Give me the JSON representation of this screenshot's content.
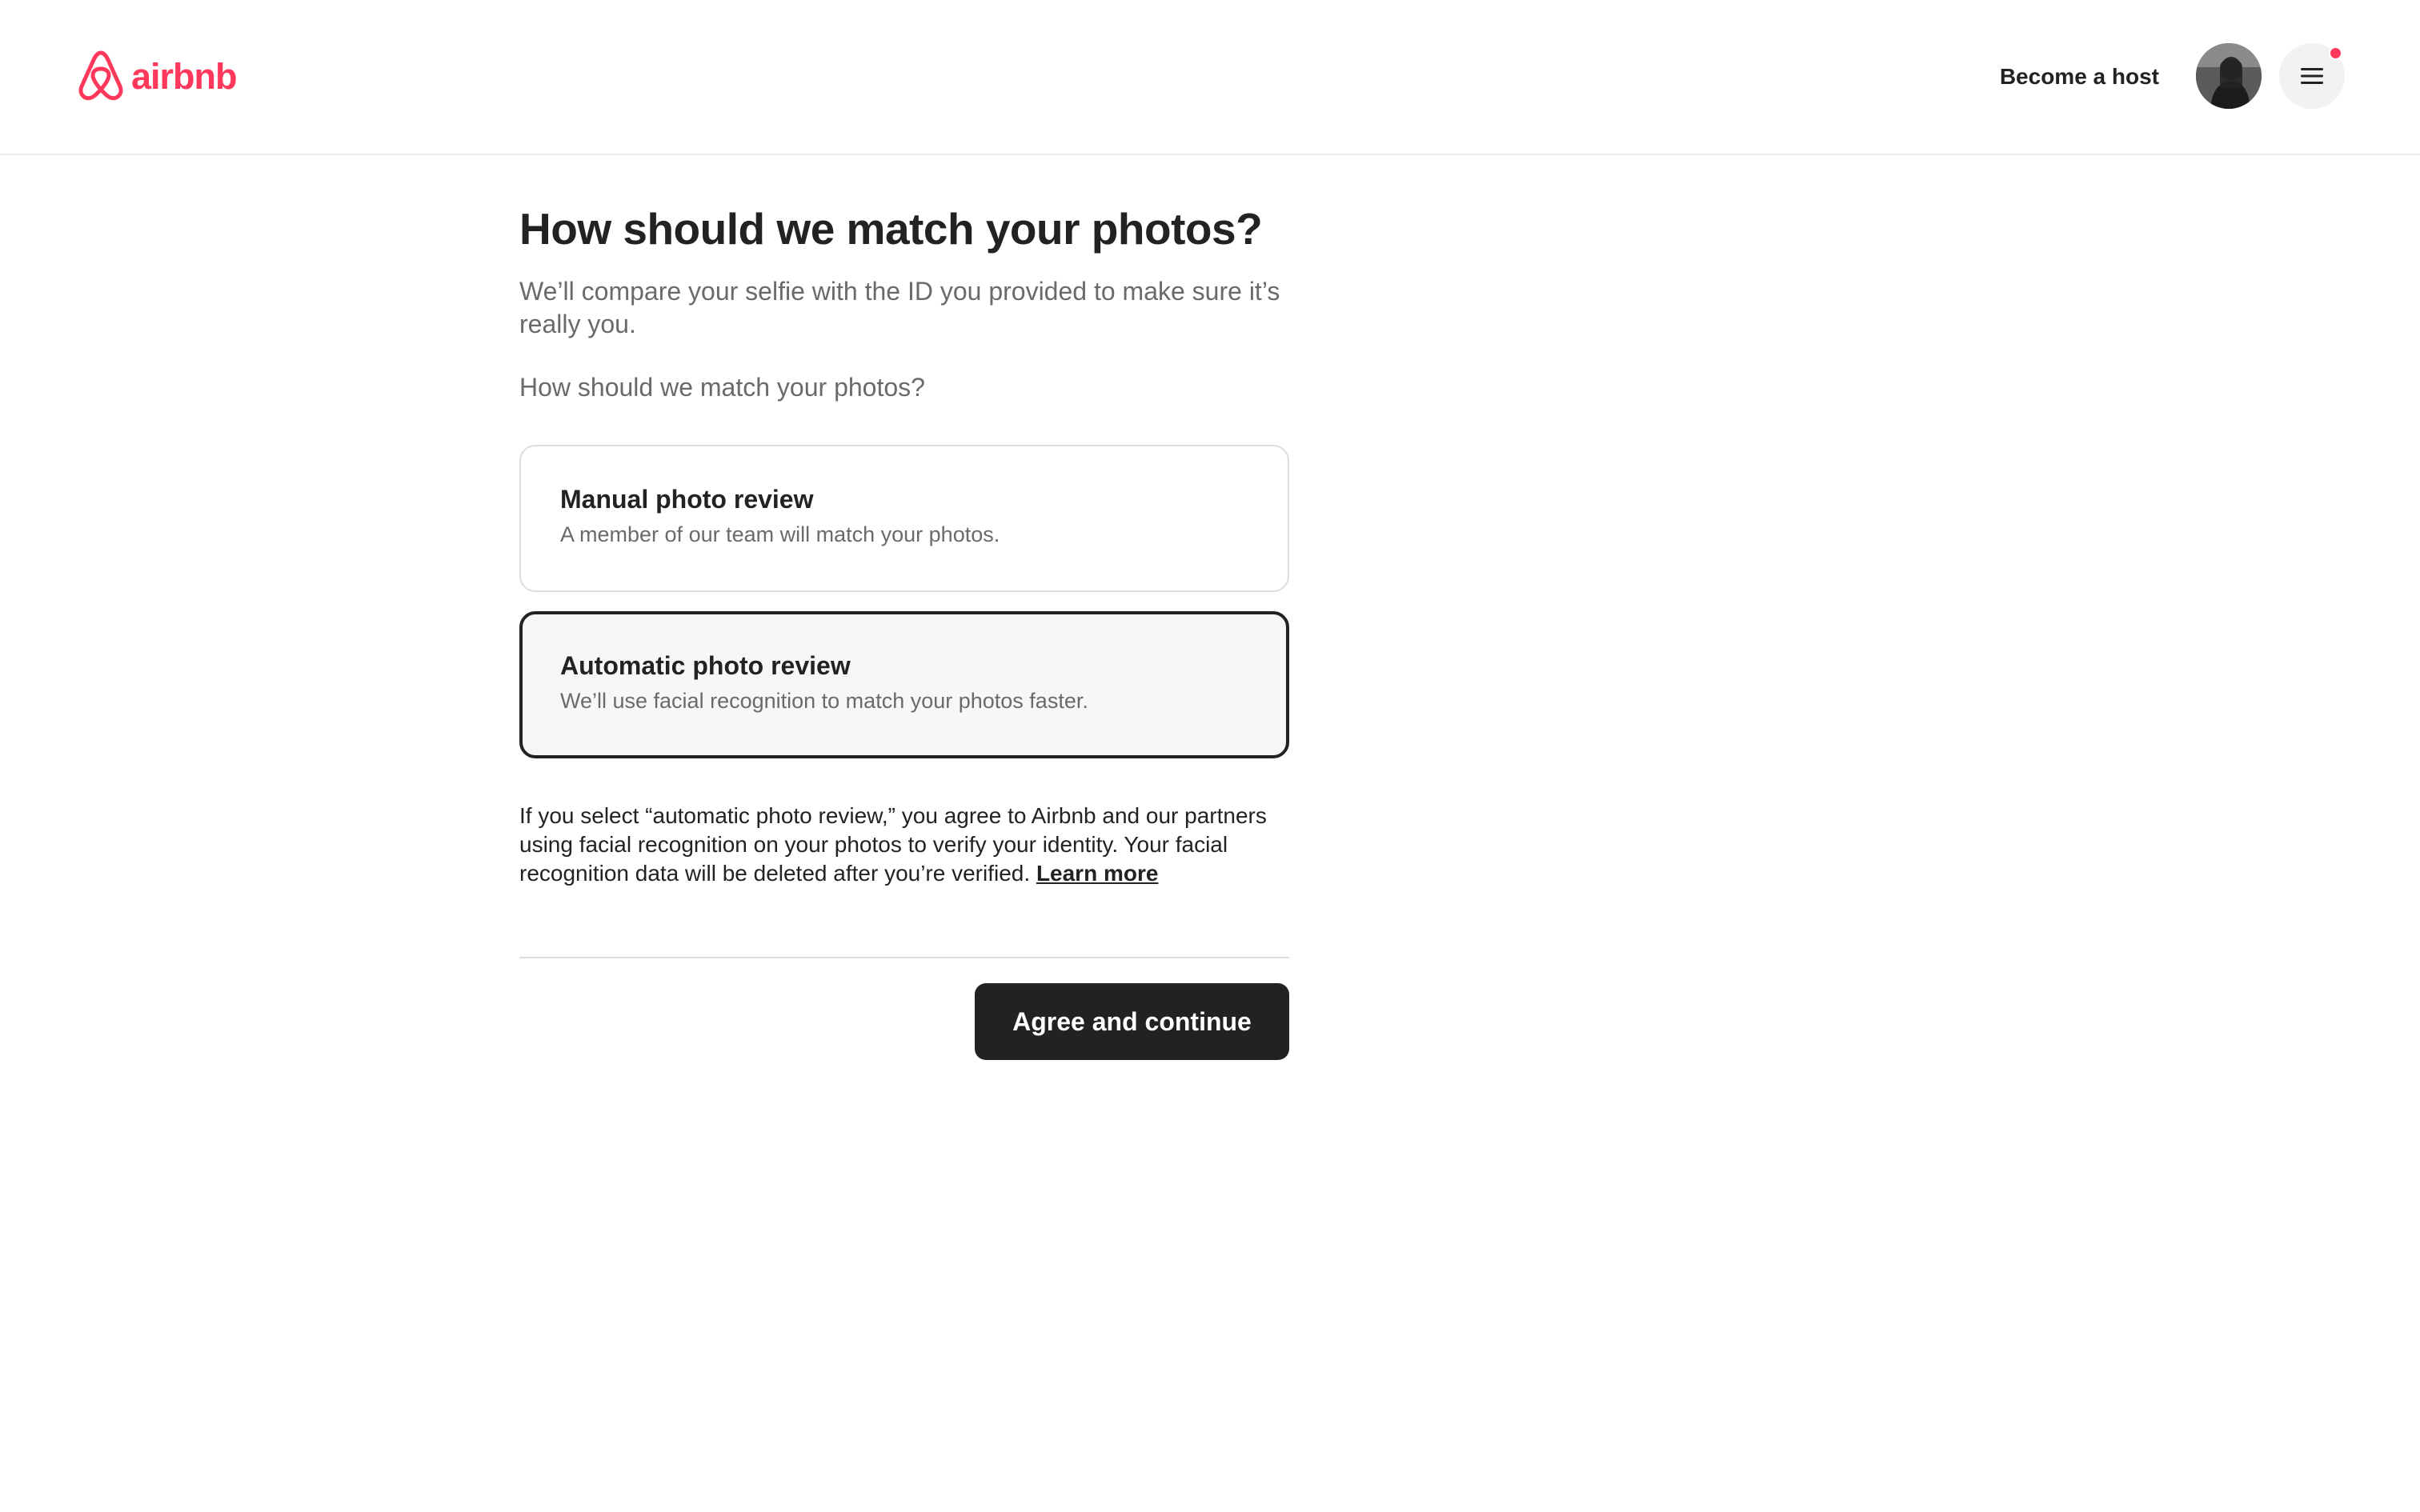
{
  "header": {
    "logo_text": "airbnb",
    "become_host_label": "Become a host",
    "avatar_icon": "user-avatar",
    "menu_icon": "hamburger-menu-icon",
    "notification_dot_color": "#ff385c",
    "brand_color": "#ff385c"
  },
  "main": {
    "title": "How should we match your photos?",
    "subtitle": "We’ll compare your selfie with the ID you provided to make sure it’s really you.",
    "question": "How should we match your photos?",
    "options": [
      {
        "title": "Manual photo review",
        "description": "A member of our team will match your photos.",
        "selected": false
      },
      {
        "title": "Automatic photo review",
        "description": "We’ll use facial recognition to match your photos faster.",
        "selected": true
      }
    ],
    "disclaimer": "If you select “automatic photo review,” you agree to Airbnb and our partners using facial recognition on your photos to verify your identity. Your facial recognition data will be deleted after you’re verified.",
    "learn_more_label": "Learn more",
    "cta_label": "Agree and continue"
  }
}
